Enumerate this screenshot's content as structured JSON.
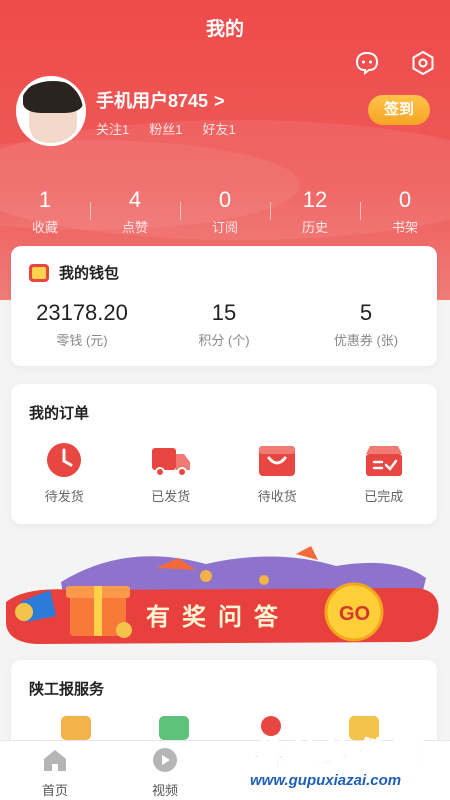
{
  "header": {
    "title": "我的",
    "username": "手机用户8745",
    "username_chevron": ">",
    "follow": "关注1",
    "fans": "粉丝1",
    "friends": "好友1",
    "signin": "签到",
    "bg_color": "#ef4a4a"
  },
  "stats": [
    {
      "num": "1",
      "label": "收藏"
    },
    {
      "num": "4",
      "label": "点赞"
    },
    {
      "num": "0",
      "label": "订阅"
    },
    {
      "num": "12",
      "label": "历史"
    },
    {
      "num": "0",
      "label": "书架"
    }
  ],
  "wallet": {
    "title": "我的钱包",
    "items": [
      {
        "value": "23178.20",
        "label": "零钱 (元)"
      },
      {
        "value": "15",
        "label": "积分 (个)"
      },
      {
        "value": "5",
        "label": "优惠券 (张)"
      }
    ]
  },
  "orders": {
    "title": "我的订单",
    "items": [
      {
        "label": "待发货",
        "icon": "clock-icon"
      },
      {
        "label": "已发货",
        "icon": "truck-icon"
      },
      {
        "label": "待收货",
        "icon": "bag-icon"
      },
      {
        "label": "已完成",
        "icon": "box-check-icon"
      }
    ]
  },
  "banner": {
    "text": "有奖问答",
    "go": "GO"
  },
  "service": {
    "title": "陕工报服务"
  },
  "tabbar": [
    {
      "label": "首页",
      "icon": "home-icon"
    },
    {
      "label": "视频",
      "icon": "play-icon"
    }
  ],
  "watermark": {
    "main": "谷普软件园",
    "url": "www.gupuxiazai.com"
  },
  "colors": {
    "accent": "#e84640",
    "signin": "#f6a524"
  }
}
